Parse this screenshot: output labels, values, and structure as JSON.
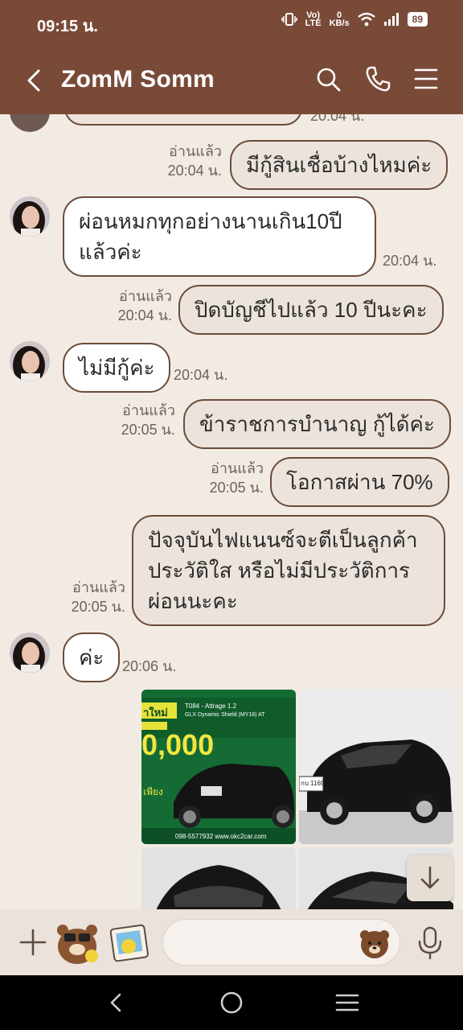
{
  "status_bar": {
    "time": "09:15 น.",
    "volte_top": "Vo)",
    "volte_bottom": "LTE",
    "kbs_top": "0",
    "kbs_bottom": "KB/s",
    "battery": "89"
  },
  "header": {
    "title": "ZomM Somm"
  },
  "messages": [
    {
      "direction": "out",
      "text": "",
      "time": "20:04 น.",
      "read": ""
    },
    {
      "direction": "out",
      "text": "มีกู้สินเชื่อบ้างไหมค่ะ",
      "time": "20:04 น.",
      "read": "อ่านแล้ว"
    },
    {
      "direction": "in",
      "text": "ผ่อนหมกทุกอย่างนานเกิน10ปีแล้วค่ะ",
      "time": "20:04 น."
    },
    {
      "direction": "out",
      "text": "ปิดบัญชีไปแล้ว 10 ปีนะคะ",
      "time": "20:04 น.",
      "read": "อ่านแล้ว"
    },
    {
      "direction": "in",
      "text": "ไม่มีกู้ค่ะ",
      "time": "20:04 น."
    },
    {
      "direction": "out",
      "text": "ข้าราชการบำนาญ กู้ได้ค่ะ",
      "time": "20:05 น.",
      "read": "อ่านแล้ว"
    },
    {
      "direction": "out",
      "text": "โอกาสผ่าน 70%",
      "time": "20:05 น.",
      "read": "อ่านแล้ว"
    },
    {
      "direction": "out",
      "text": "ปัจจุบันไฟแนนซ์จะตีเป็นลูกค้าประวัติใส หรือไม่มีประวัติการผ่อนนะคะ",
      "time": "20:05 น.",
      "read": "อ่านแล้ว"
    },
    {
      "direction": "in",
      "text": "ค่ะ",
      "time": "20:06 น."
    }
  ],
  "media": {
    "ad_model": "T084 - Attrage 1.2",
    "ad_trim": "GLX Dynamic Shield (MY18) AT",
    "ad_new": "าใหม่",
    "ad_price": "0,000",
    "ad_monthly": "เพียง",
    "ad_phone": "098-5577932  www.okc2car.com",
    "plate": "กบ 1169"
  },
  "input": {
    "placeholder": ""
  },
  "colors": {
    "header": "#7a4a38",
    "chat_bg": "#f2ebe4",
    "bubble_border": "#6b4c3b",
    "incoming_bubble": "#ffffff",
    "outgoing_bubble": "#ece4dc"
  }
}
